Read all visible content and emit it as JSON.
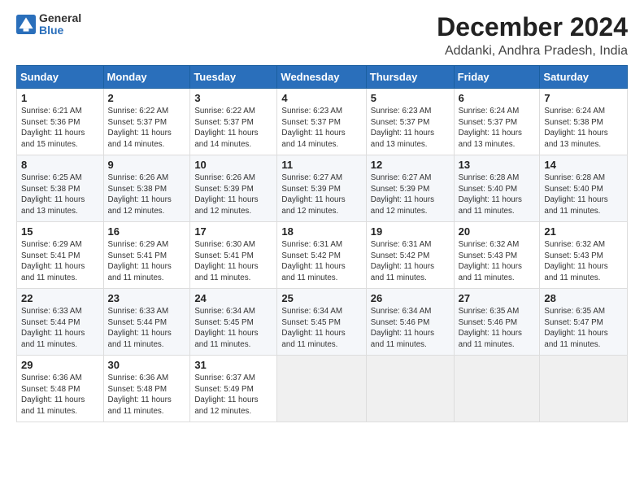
{
  "logo": {
    "line1": "General",
    "line2": "Blue"
  },
  "title": "December 2024",
  "subtitle": "Addanki, Andhra Pradesh, India",
  "weekdays": [
    "Sunday",
    "Monday",
    "Tuesday",
    "Wednesday",
    "Thursday",
    "Friday",
    "Saturday"
  ],
  "weeks": [
    [
      {
        "day": "1",
        "detail": "Sunrise: 6:21 AM\nSunset: 5:36 PM\nDaylight: 11 hours\nand 15 minutes."
      },
      {
        "day": "2",
        "detail": "Sunrise: 6:22 AM\nSunset: 5:37 PM\nDaylight: 11 hours\nand 14 minutes."
      },
      {
        "day": "3",
        "detail": "Sunrise: 6:22 AM\nSunset: 5:37 PM\nDaylight: 11 hours\nand 14 minutes."
      },
      {
        "day": "4",
        "detail": "Sunrise: 6:23 AM\nSunset: 5:37 PM\nDaylight: 11 hours\nand 14 minutes."
      },
      {
        "day": "5",
        "detail": "Sunrise: 6:23 AM\nSunset: 5:37 PM\nDaylight: 11 hours\nand 13 minutes."
      },
      {
        "day": "6",
        "detail": "Sunrise: 6:24 AM\nSunset: 5:37 PM\nDaylight: 11 hours\nand 13 minutes."
      },
      {
        "day": "7",
        "detail": "Sunrise: 6:24 AM\nSunset: 5:38 PM\nDaylight: 11 hours\nand 13 minutes."
      }
    ],
    [
      {
        "day": "8",
        "detail": "Sunrise: 6:25 AM\nSunset: 5:38 PM\nDaylight: 11 hours\nand 13 minutes."
      },
      {
        "day": "9",
        "detail": "Sunrise: 6:26 AM\nSunset: 5:38 PM\nDaylight: 11 hours\nand 12 minutes."
      },
      {
        "day": "10",
        "detail": "Sunrise: 6:26 AM\nSunset: 5:39 PM\nDaylight: 11 hours\nand 12 minutes."
      },
      {
        "day": "11",
        "detail": "Sunrise: 6:27 AM\nSunset: 5:39 PM\nDaylight: 11 hours\nand 12 minutes."
      },
      {
        "day": "12",
        "detail": "Sunrise: 6:27 AM\nSunset: 5:39 PM\nDaylight: 11 hours\nand 12 minutes."
      },
      {
        "day": "13",
        "detail": "Sunrise: 6:28 AM\nSunset: 5:40 PM\nDaylight: 11 hours\nand 11 minutes."
      },
      {
        "day": "14",
        "detail": "Sunrise: 6:28 AM\nSunset: 5:40 PM\nDaylight: 11 hours\nand 11 minutes."
      }
    ],
    [
      {
        "day": "15",
        "detail": "Sunrise: 6:29 AM\nSunset: 5:41 PM\nDaylight: 11 hours\nand 11 minutes."
      },
      {
        "day": "16",
        "detail": "Sunrise: 6:29 AM\nSunset: 5:41 PM\nDaylight: 11 hours\nand 11 minutes."
      },
      {
        "day": "17",
        "detail": "Sunrise: 6:30 AM\nSunset: 5:41 PM\nDaylight: 11 hours\nand 11 minutes."
      },
      {
        "day": "18",
        "detail": "Sunrise: 6:31 AM\nSunset: 5:42 PM\nDaylight: 11 hours\nand 11 minutes."
      },
      {
        "day": "19",
        "detail": "Sunrise: 6:31 AM\nSunset: 5:42 PM\nDaylight: 11 hours\nand 11 minutes."
      },
      {
        "day": "20",
        "detail": "Sunrise: 6:32 AM\nSunset: 5:43 PM\nDaylight: 11 hours\nand 11 minutes."
      },
      {
        "day": "21",
        "detail": "Sunrise: 6:32 AM\nSunset: 5:43 PM\nDaylight: 11 hours\nand 11 minutes."
      }
    ],
    [
      {
        "day": "22",
        "detail": "Sunrise: 6:33 AM\nSunset: 5:44 PM\nDaylight: 11 hours\nand 11 minutes."
      },
      {
        "day": "23",
        "detail": "Sunrise: 6:33 AM\nSunset: 5:44 PM\nDaylight: 11 hours\nand 11 minutes."
      },
      {
        "day": "24",
        "detail": "Sunrise: 6:34 AM\nSunset: 5:45 PM\nDaylight: 11 hours\nand 11 minutes."
      },
      {
        "day": "25",
        "detail": "Sunrise: 6:34 AM\nSunset: 5:45 PM\nDaylight: 11 hours\nand 11 minutes."
      },
      {
        "day": "26",
        "detail": "Sunrise: 6:34 AM\nSunset: 5:46 PM\nDaylight: 11 hours\nand 11 minutes."
      },
      {
        "day": "27",
        "detail": "Sunrise: 6:35 AM\nSunset: 5:46 PM\nDaylight: 11 hours\nand 11 minutes."
      },
      {
        "day": "28",
        "detail": "Sunrise: 6:35 AM\nSunset: 5:47 PM\nDaylight: 11 hours\nand 11 minutes."
      }
    ],
    [
      {
        "day": "29",
        "detail": "Sunrise: 6:36 AM\nSunset: 5:48 PM\nDaylight: 11 hours\nand 11 minutes."
      },
      {
        "day": "30",
        "detail": "Sunrise: 6:36 AM\nSunset: 5:48 PM\nDaylight: 11 hours\nand 11 minutes."
      },
      {
        "day": "31",
        "detail": "Sunrise: 6:37 AM\nSunset: 5:49 PM\nDaylight: 11 hours\nand 12 minutes."
      },
      null,
      null,
      null,
      null
    ]
  ]
}
